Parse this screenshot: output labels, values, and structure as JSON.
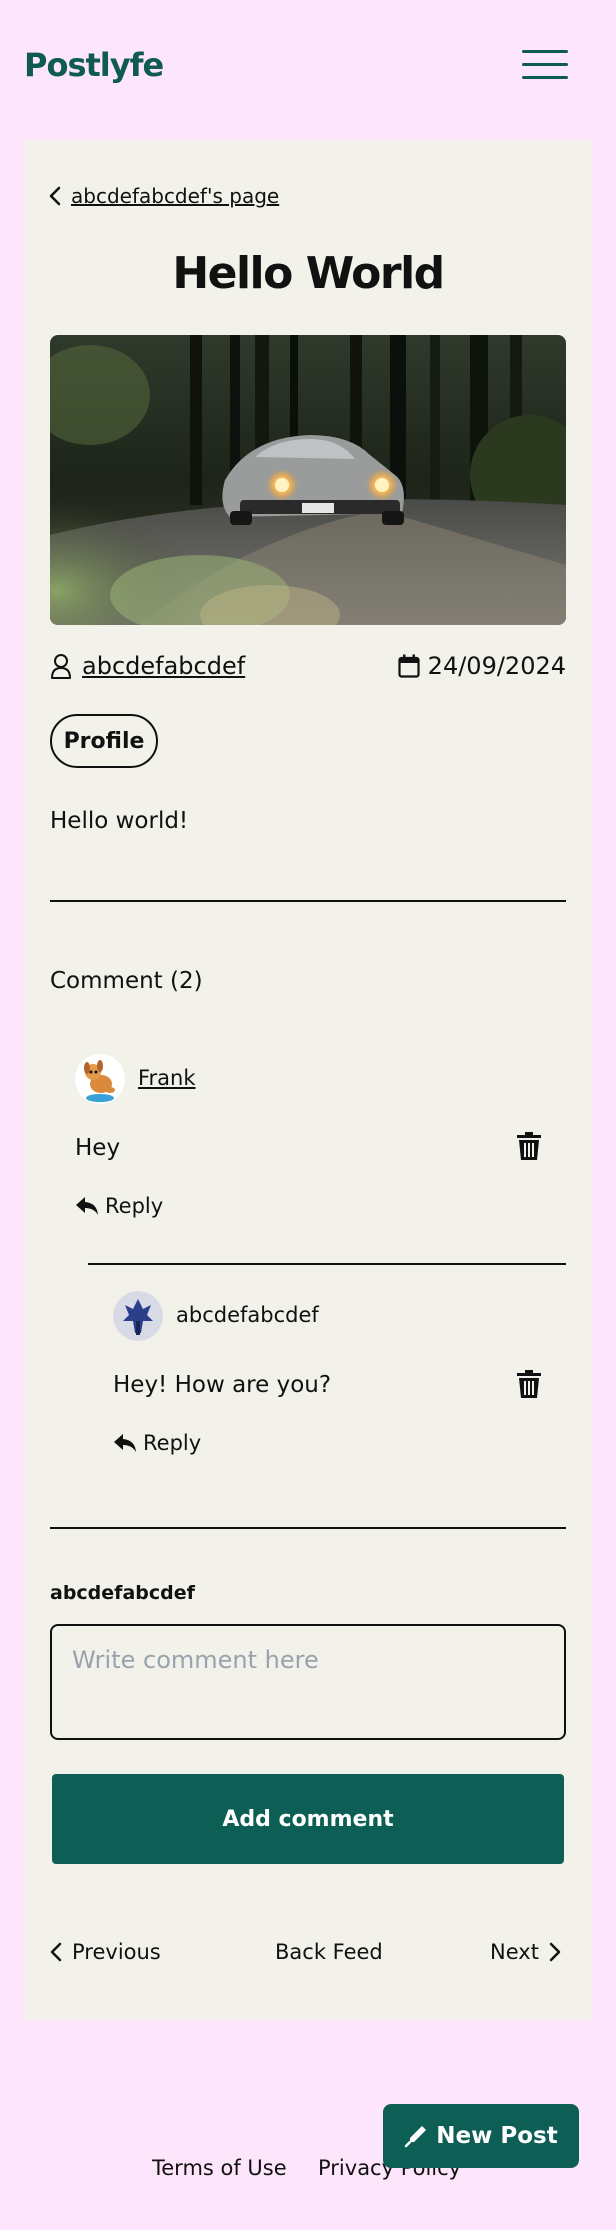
{
  "header": {
    "logo": "Postlyfe",
    "menu_icon": "hamburger-menu-icon"
  },
  "post": {
    "back_link": "abcdefabcdef's page",
    "title": "Hello World",
    "image_desc_icon": "post-image",
    "author": "abcdefabcdef",
    "date": "24/09/2024",
    "profile_button": "Profile",
    "body": "Hello world!"
  },
  "comments": {
    "heading": "Comment (2)",
    "items": [
      {
        "author": "Frank",
        "text": "Hey",
        "reply_label": "Reply",
        "replies": [
          {
            "author": "abcdefabcdef",
            "text": "Hey! How are you?",
            "reply_label": "Reply"
          }
        ]
      }
    ]
  },
  "comment_form": {
    "user_label": "abcdefabcdef",
    "placeholder": "Write comment here",
    "submit_label": "Add comment"
  },
  "pagination": {
    "previous": "Previous",
    "back_feed": "Back Feed",
    "next": "Next"
  },
  "footer": {
    "terms": "Terms of Use",
    "privacy": "Privacy Policy"
  },
  "fab": {
    "label": "New Post"
  },
  "colors": {
    "brand": "#0d5e55",
    "page_bg": "#fde6fb",
    "card_bg": "#f2f1ea"
  }
}
